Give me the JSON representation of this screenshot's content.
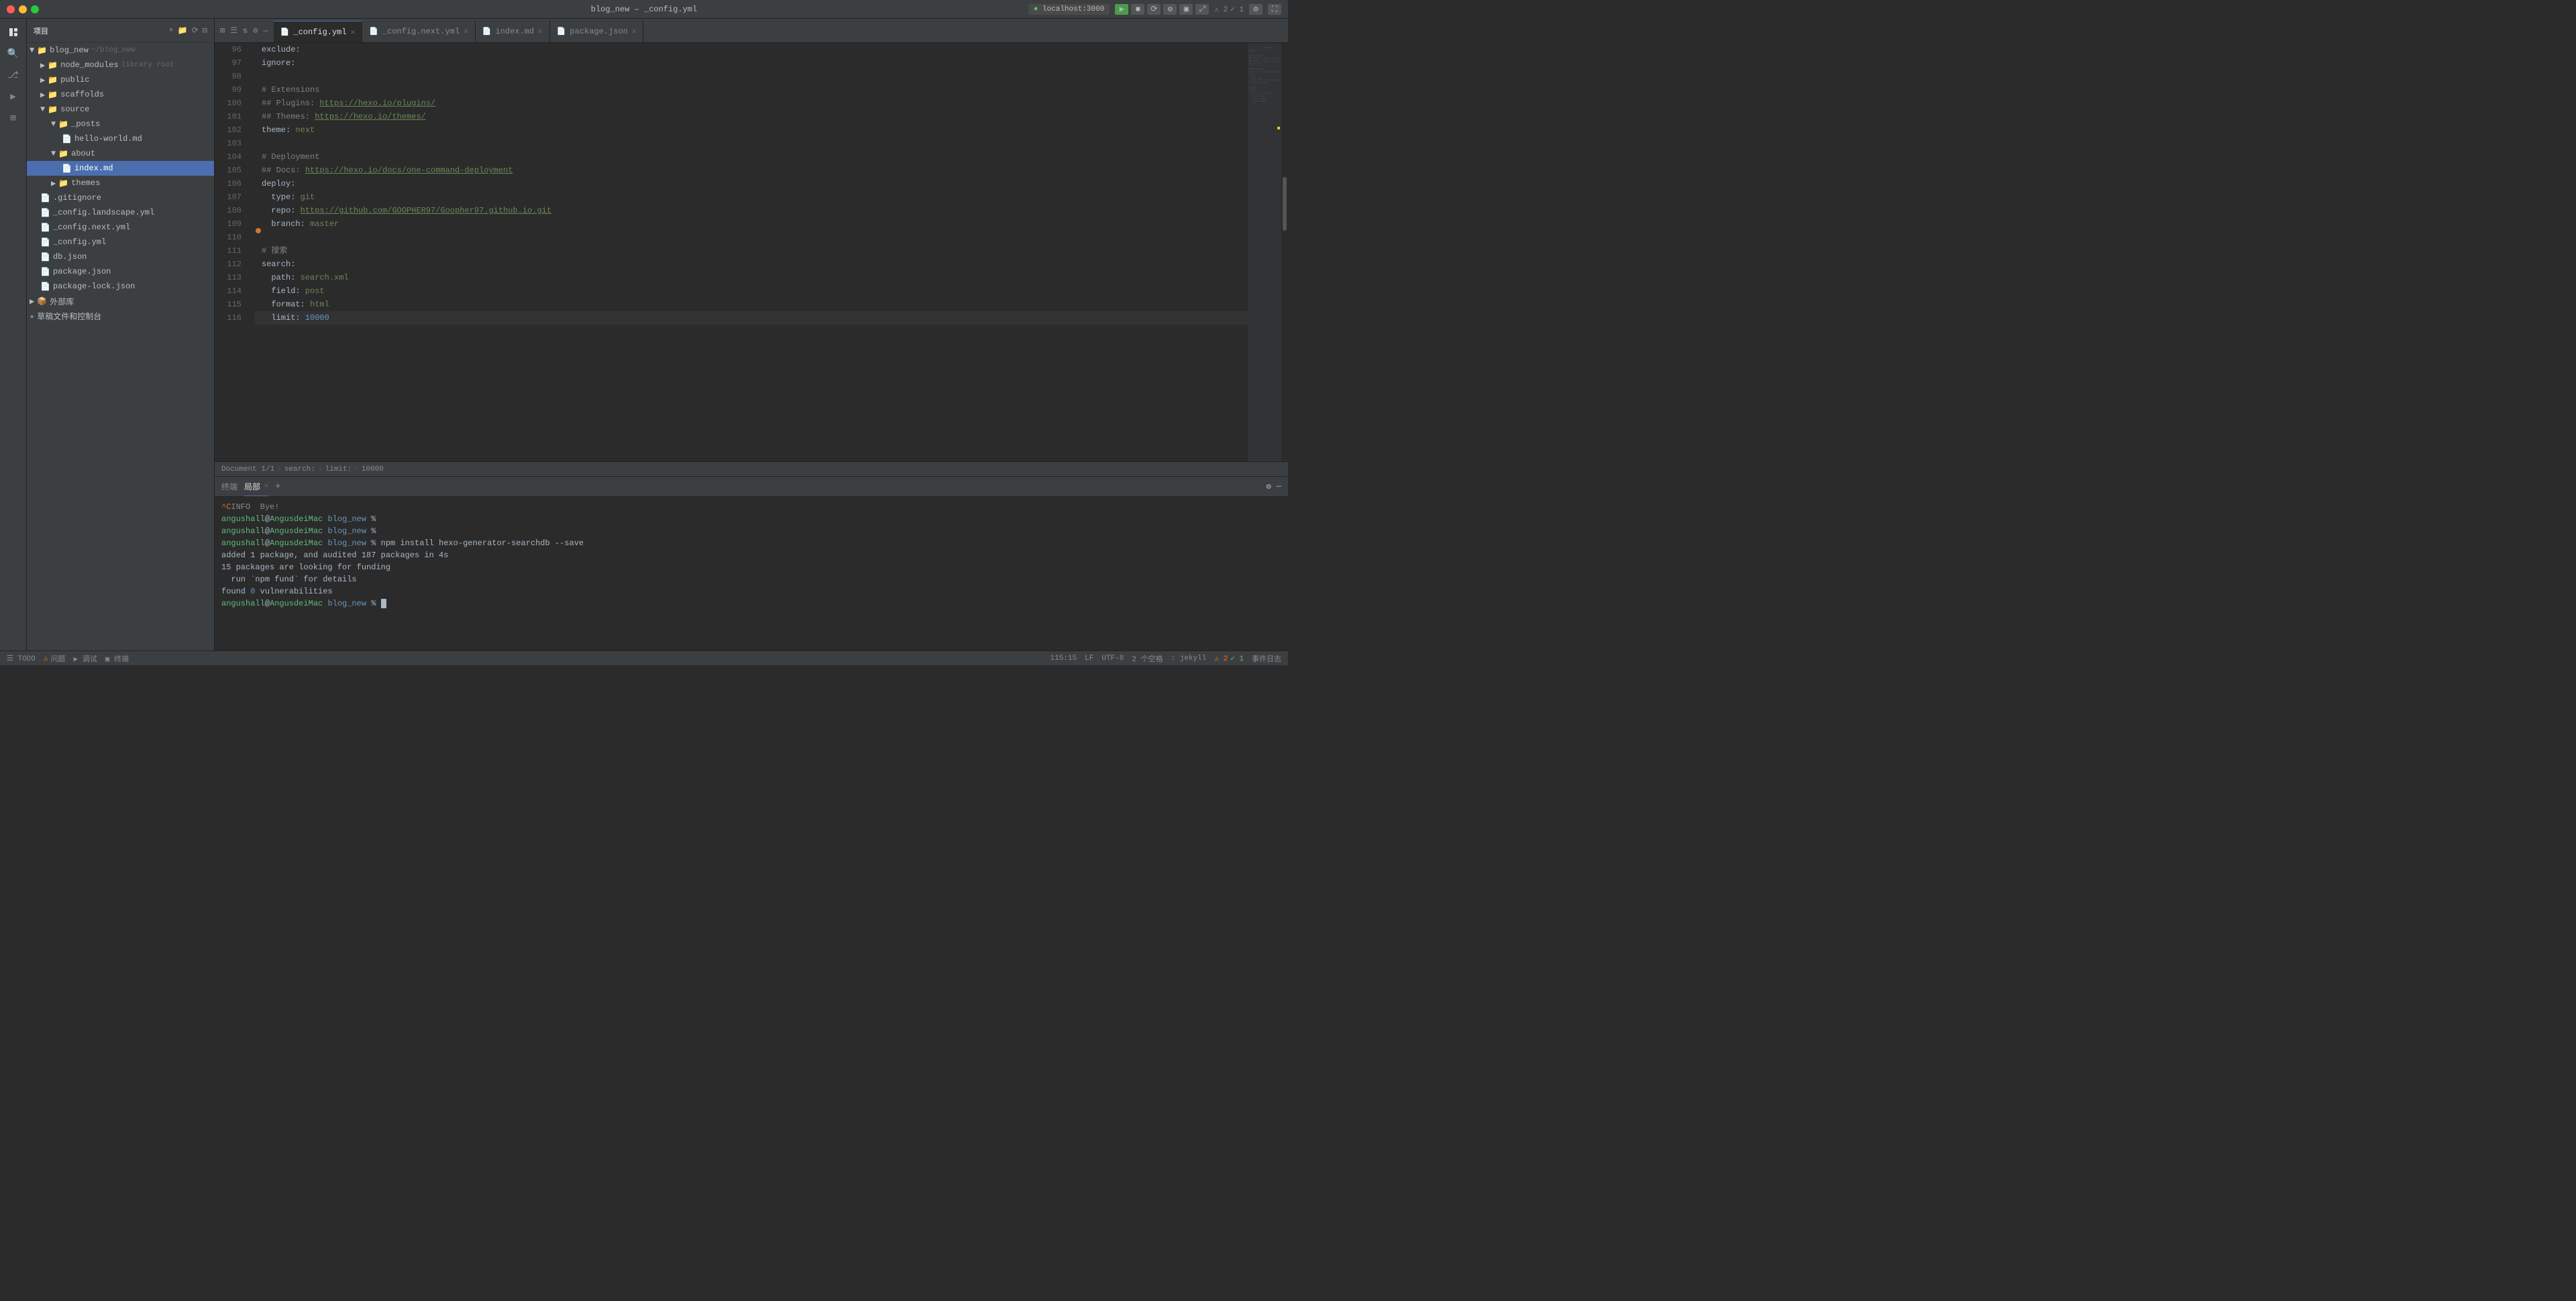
{
  "window": {
    "title": "blog_new – _config.yml"
  },
  "titlebar": {
    "title": "blog_new – _config.yml",
    "server_btn": "localhost:3000"
  },
  "explorer": {
    "title": "项目",
    "root": "blog_new",
    "root_path": "~/blog_new",
    "items": [
      {
        "id": "node_modules",
        "label": "node_modules",
        "secondary": "library root",
        "type": "folder",
        "depth": 1
      },
      {
        "id": "public",
        "label": "public",
        "type": "folder",
        "depth": 1
      },
      {
        "id": "scaffolds",
        "label": "scaffolds",
        "type": "folder",
        "depth": 1
      },
      {
        "id": "source",
        "label": "source",
        "type": "folder",
        "depth": 1
      },
      {
        "id": "_posts",
        "label": "_posts",
        "type": "folder",
        "depth": 2
      },
      {
        "id": "hello-world",
        "label": "hello-world.md",
        "type": "md",
        "depth": 3
      },
      {
        "id": "about",
        "label": "about",
        "type": "folder",
        "depth": 2
      },
      {
        "id": "index-md",
        "label": "index.md",
        "type": "md",
        "depth": 3,
        "active": true
      },
      {
        "id": "themes",
        "label": "themes",
        "type": "folder",
        "depth": 2
      },
      {
        "id": "gitignore",
        "label": ".gitignore",
        "type": "git",
        "depth": 1
      },
      {
        "id": "config-landscape",
        "label": "_config.landscape.yml",
        "type": "yaml",
        "depth": 1
      },
      {
        "id": "config-next",
        "label": "_config.next.yml",
        "type": "yaml",
        "depth": 1
      },
      {
        "id": "config-yml",
        "label": "_config.yml",
        "type": "yaml",
        "depth": 1
      },
      {
        "id": "db-json",
        "label": "db.json",
        "type": "json",
        "depth": 1
      },
      {
        "id": "package-json",
        "label": "package.json",
        "type": "json",
        "depth": 1
      },
      {
        "id": "package-lock",
        "label": "package-lock.json",
        "type": "json",
        "depth": 1
      },
      {
        "id": "waigaoku",
        "label": "外部库",
        "type": "folder-special",
        "depth": 0
      },
      {
        "id": "caogao",
        "label": "草稿文件和控制台",
        "type": "folder-special",
        "depth": 0
      }
    ]
  },
  "tabs": [
    {
      "id": "config-yml",
      "label": "_config.yml",
      "active": true,
      "icon": "yaml"
    },
    {
      "id": "config-next-yml",
      "label": "_config.next.yml",
      "active": false,
      "icon": "yaml"
    },
    {
      "id": "index-md",
      "label": "index.md",
      "active": false,
      "icon": "md"
    },
    {
      "id": "package-json",
      "label": "package.json",
      "active": false,
      "icon": "json"
    }
  ],
  "editor": {
    "lines": [
      {
        "num": 96,
        "content": "exclude:",
        "indent": 0
      },
      {
        "num": 97,
        "content": "ignore:",
        "indent": 0
      },
      {
        "num": 98,
        "content": "",
        "indent": 0
      },
      {
        "num": 99,
        "content": "# Extensions",
        "indent": 0,
        "type": "comment"
      },
      {
        "num": 100,
        "content": "## Plugins: https://hexo.io/plugins/",
        "indent": 0,
        "type": "comment-link"
      },
      {
        "num": 101,
        "content": "## Themes: https://hexo.io/themes/",
        "indent": 0,
        "type": "comment-link"
      },
      {
        "num": 102,
        "content": "theme: next",
        "indent": 0
      },
      {
        "num": 103,
        "content": "",
        "indent": 0
      },
      {
        "num": 104,
        "content": "# Deployment",
        "indent": 0,
        "type": "comment"
      },
      {
        "num": 105,
        "content": "## Docs: https://hexo.io/docs/one-command-deployment",
        "indent": 0,
        "type": "comment-link"
      },
      {
        "num": 106,
        "content": "deploy:",
        "indent": 0
      },
      {
        "num": 107,
        "content": "  type: git",
        "indent": 2
      },
      {
        "num": 108,
        "content": "  repo: https://github.com/GOOPHER97/Goopher97.github.io.git",
        "indent": 2
      },
      {
        "num": 109,
        "content": "  branch: master",
        "indent": 2,
        "breakpoint": true
      },
      {
        "num": 110,
        "content": "",
        "indent": 0
      },
      {
        "num": 111,
        "content": "# 搜索",
        "indent": 0,
        "type": "comment"
      },
      {
        "num": 112,
        "content": "search:",
        "indent": 0
      },
      {
        "num": 113,
        "content": "  path: search.xml",
        "indent": 2
      },
      {
        "num": 114,
        "content": "  field: post",
        "indent": 2
      },
      {
        "num": 115,
        "content": "  format: html",
        "indent": 2
      },
      {
        "num": 116,
        "content": "  limit: 10000",
        "indent": 2,
        "highlighted": true
      }
    ]
  },
  "status_bar": {
    "breadcrumb": [
      "Document 1/1",
      "search:",
      "limit:",
      "10000"
    ]
  },
  "terminal": {
    "tabs": [
      "终端",
      "局部"
    ],
    "active_tab": "局部",
    "lines": [
      {
        "text": "^C",
        "type": "warn-prefix"
      },
      {
        "text": "INFO  Bye!",
        "type": "info"
      },
      {
        "prompt": "angushall@AngusdeiMac blog_new %",
        "cmd": ""
      },
      {
        "prompt": "angushall@AngusdeiMac blog_new %",
        "cmd": ""
      },
      {
        "prompt": "angushall@AngusdeiMac blog_new %",
        "cmd": " npm install hexo-generator-searchdb --save"
      },
      {
        "text": ""
      },
      {
        "text": "added 1 package, and audited 187 packages in 4s"
      },
      {
        "text": ""
      },
      {
        "text": "15 packages are looking for funding"
      },
      {
        "text": "  run `npm fund` for details"
      },
      {
        "text": ""
      },
      {
        "text": "found 0 vulnerabilities"
      },
      {
        "prompt": "angushall@AngusdeiMac blog_new %",
        "cmd": "",
        "cursor": true
      }
    ]
  },
  "bottom_bar": {
    "left": [
      {
        "icon": "todo",
        "label": "TODO"
      },
      {
        "icon": "warning",
        "label": "⚠ 问题"
      },
      {
        "icon": "test",
        "label": "▶ 调试"
      },
      {
        "icon": "terminal",
        "label": "▣ 终端"
      }
    ],
    "right": [
      {
        "label": "115:15"
      },
      {
        "label": "LF"
      },
      {
        "label": "UTF-8"
      },
      {
        "label": "2 个空格"
      },
      {
        "label": ": jekyll"
      },
      {
        "label": "⚠ 2  ✓ 1"
      },
      {
        "label": "事件日志"
      }
    ]
  }
}
